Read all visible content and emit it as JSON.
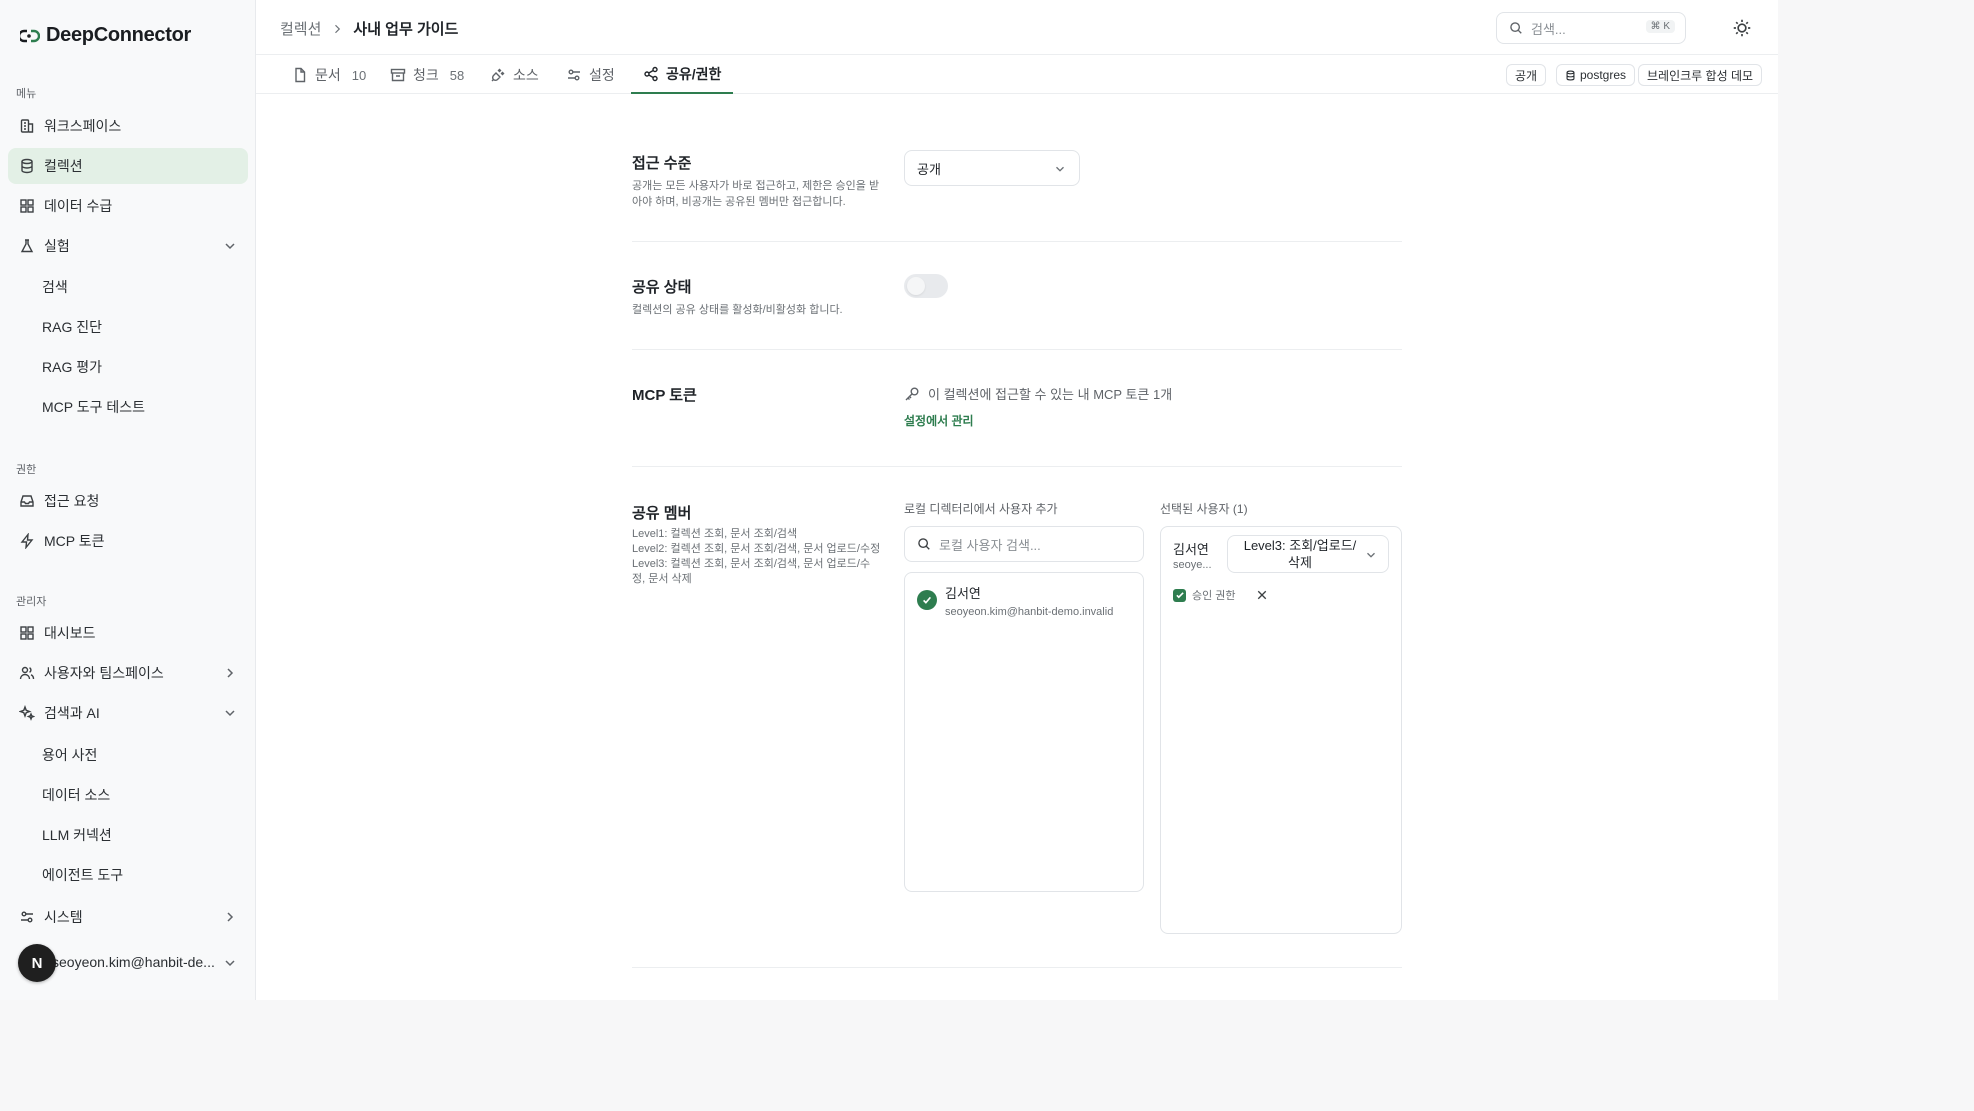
{
  "app": {
    "name": "DeepConnector"
  },
  "sidebar": {
    "sections": {
      "menu": "메뉴",
      "permissions": "권한",
      "admin": "관리자"
    },
    "menu_items": [
      {
        "label": "워크스페이스"
      },
      {
        "label": "컬렉션"
      },
      {
        "label": "데이터 수급"
      },
      {
        "label": "실험"
      }
    ],
    "experiment_sub": [
      "검색",
      "RAG 진단",
      "RAG 평가",
      "MCP 도구 테스트"
    ],
    "permission_items": [
      {
        "label": "접근 요청"
      },
      {
        "label": "MCP 토큰"
      }
    ],
    "admin_items": [
      {
        "label": "대시보드"
      },
      {
        "label": "사용자와 팀스페이스"
      },
      {
        "label": "검색과 AI"
      }
    ],
    "search_ai_sub": [
      "용어 사전",
      "데이터 소스",
      "LLM 커넥션",
      "에이전트 도구"
    ],
    "system_item": {
      "label": "시스템"
    },
    "user": {
      "avatar_letter": "N",
      "email": "seoyeon.kim@hanbit-de..."
    }
  },
  "header": {
    "breadcrumb_parent": "컬렉션",
    "breadcrumb_current": "사내 업무 가이드",
    "search_placeholder": "검색...",
    "search_shortcut": "⌘ K"
  },
  "tabs": [
    {
      "label": "문서",
      "count": "10"
    },
    {
      "label": "청크",
      "count": "58"
    },
    {
      "label": "소스",
      "count": ""
    },
    {
      "label": "설정",
      "count": ""
    },
    {
      "label": "공유/권한",
      "count": ""
    }
  ],
  "badges": {
    "visibility": "공개",
    "db": "postgres",
    "source": "브레인크루 합성 데모"
  },
  "access": {
    "title": "접근 수준",
    "desc": "공개는 모든 사용자가 바로 접근하고, 제한은 승인을 받아야 하며, 비공개는 공유된 멤버만 접근합니다.",
    "value": "공개"
  },
  "share_status": {
    "title": "공유 상태",
    "desc": "컬렉션의 공유 상태를 활성화/비활성화 합니다.",
    "enabled": false
  },
  "mcp": {
    "title": "MCP 토큰",
    "info": "이 컬렉션에 접근할 수 있는 내 MCP 토큰 1개",
    "manage_link": "설정에서 관리"
  },
  "members": {
    "title": "공유 멤버",
    "levels": [
      "Level1: 컬렉션 조회, 문서 조회/검색",
      "Level2: 컬렉션 조회, 문서 조회/검색, 문서 업로드/수정",
      "Level3: 컬렉션 조회, 문서 조회/검색, 문서 업로드/수정, 문서 삭제"
    ],
    "add_label": "로컬 디렉터리에서 사용자 추가",
    "search_placeholder": "로컬 사용자 검색...",
    "directory": [
      {
        "name": "김서연",
        "email": "seoyeon.kim@hanbit-demo.invalid"
      }
    ],
    "selected_label": "선택된 사용자 (1)",
    "selected": [
      {
        "name": "김서연",
        "email": "seoye...",
        "level": "Level3: 조회/업로드/삭제",
        "approve_label": "승인 권한"
      }
    ]
  },
  "colors": {
    "accent": "#2e7d4f",
    "active_bg": "#e3f0e6"
  }
}
